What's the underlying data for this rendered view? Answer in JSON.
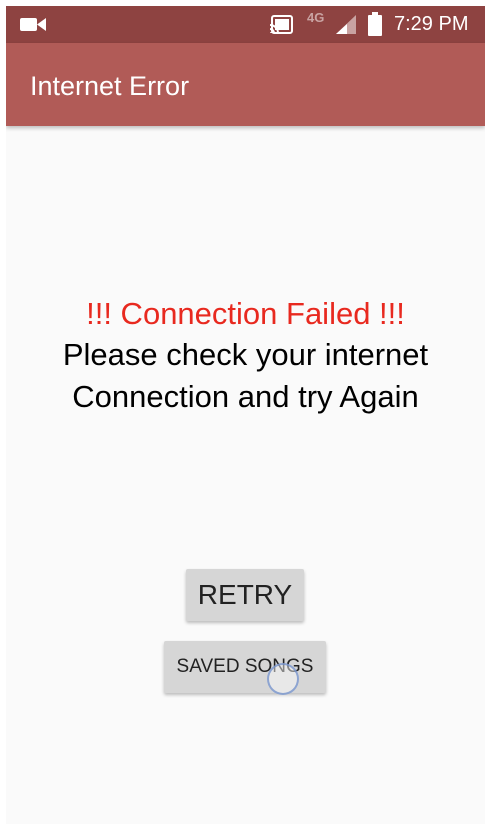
{
  "status_bar": {
    "network_type": "4G",
    "time": "7:29 PM",
    "icons": [
      "video-camera-icon",
      "cast-icon",
      "signal-icon",
      "battery-icon"
    ]
  },
  "app_bar": {
    "title": "Internet Error"
  },
  "message": {
    "headline": "!!! Connection Failed !!!",
    "line1": "Please check your internet",
    "line2": "Connection and try Again"
  },
  "buttons": {
    "retry_label": "RETRY",
    "saved_songs_label": "SAVED SONGS"
  },
  "colors": {
    "status_bar": "#8e4341",
    "app_bar": "#b15b57",
    "error_text": "#e8291f",
    "button_bg": "#d6d6d6",
    "background": "#fafafa"
  }
}
